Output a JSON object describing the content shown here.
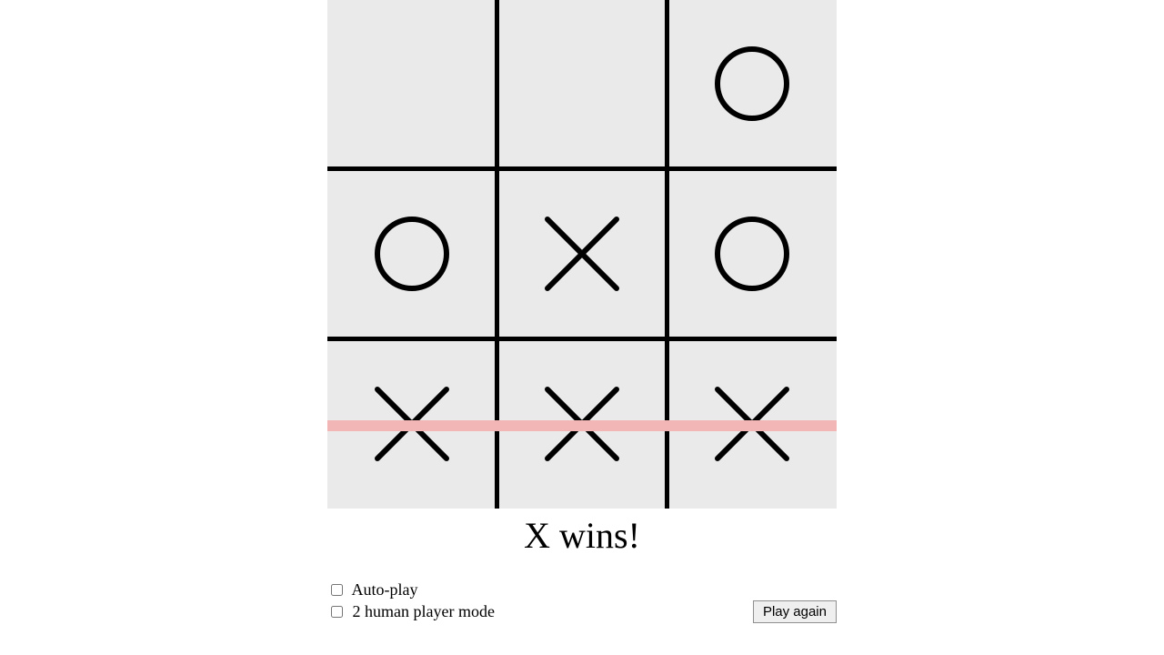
{
  "game": {
    "board": [
      [
        "",
        "",
        "O"
      ],
      [
        "O",
        "X",
        "O"
      ],
      [
        "X",
        "X",
        "X"
      ]
    ],
    "winning_row": 2,
    "status_text": "X wins!"
  },
  "controls": {
    "autoplay_label": "Auto-play",
    "autoplay_checked": false,
    "two_human_label": "2 human player mode",
    "two_human_checked": false,
    "play_again_label": "Play again"
  }
}
